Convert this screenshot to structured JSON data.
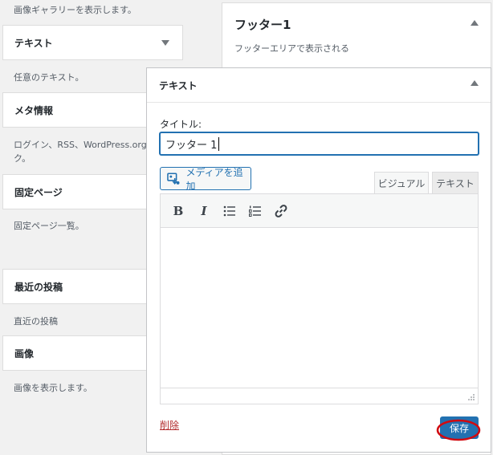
{
  "available_widgets": {
    "gallery_desc": "画像ギャラリーを表示します。",
    "text": {
      "title": "テキスト",
      "desc": "任意のテキスト。"
    },
    "meta": {
      "title": "メタ情報",
      "desc_line1": "ログイン、RSS、WordPress.org へのリン",
      "desc_line2": "ク。"
    },
    "pages": {
      "title": "固定ページ",
      "desc": "固定ページ一覧。"
    },
    "recent_posts": {
      "title": "最近の投稿",
      "desc": "直近の投稿"
    },
    "image": {
      "title": "画像",
      "desc": "画像を表示します。"
    }
  },
  "sidebar": {
    "title": "フッター1",
    "desc": "フッターエリアで表示される"
  },
  "open_widget": {
    "header": "テキスト",
    "title_label": "タイトル:",
    "title_value": "フッター 1",
    "add_media": "メディアを追加",
    "tabs": {
      "visual": "ビジュアル",
      "text": "テキスト"
    },
    "delete": "削除",
    "save": "保存"
  },
  "colors": {
    "accent": "#2271b1",
    "delete": "#b32d2e",
    "highlight_circle": "#d10a10"
  }
}
